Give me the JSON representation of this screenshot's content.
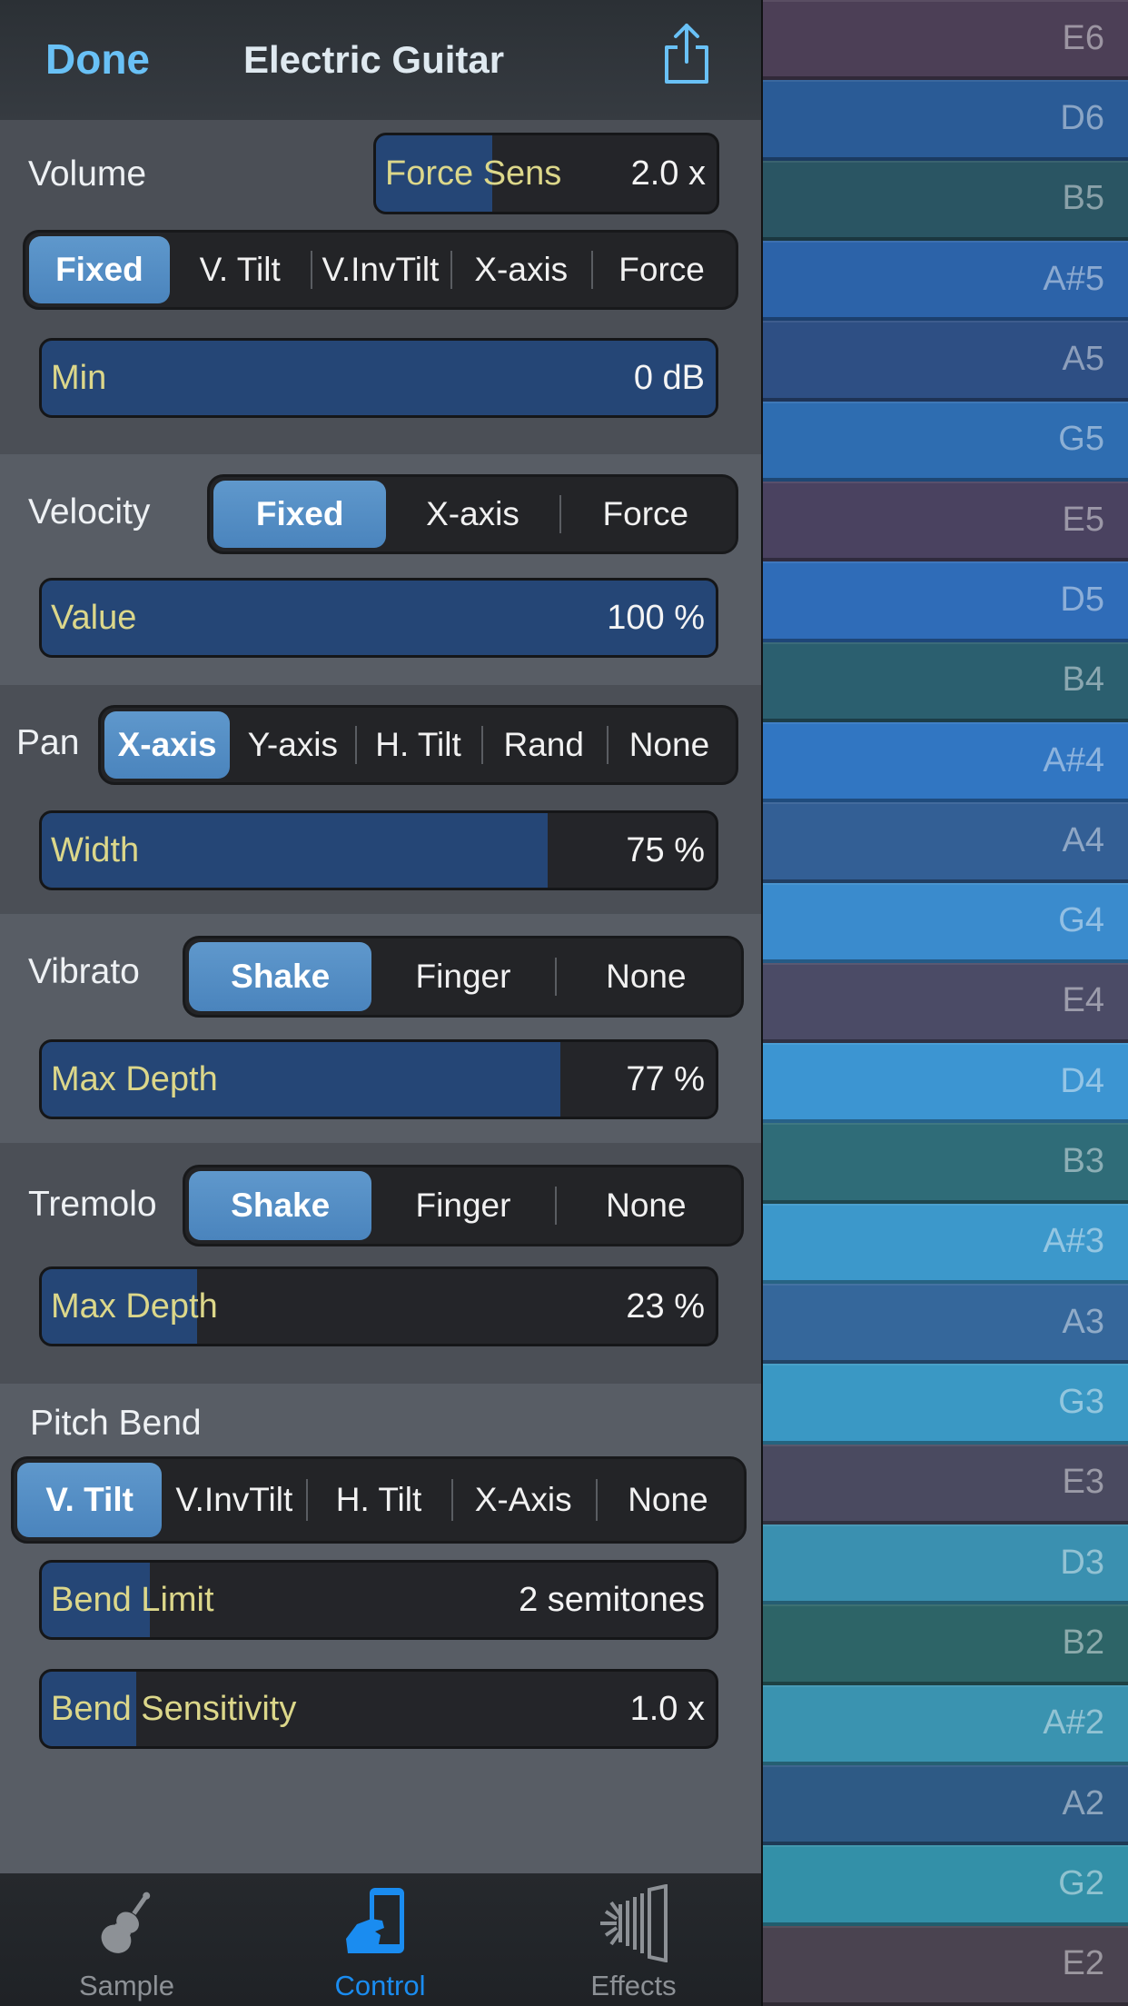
{
  "header": {
    "done_label": "Done",
    "title": "Electric Guitar"
  },
  "volume": {
    "label": "Volume",
    "force_sens": {
      "label": "Force Sens",
      "value": "2.0 x",
      "level": 0.34
    },
    "options": [
      "Fixed",
      "V. Tilt",
      "V.InvTilt",
      "X-axis",
      "Force"
    ],
    "selected": 0,
    "min": {
      "label": "Min",
      "value": "0 dB",
      "level": 1.0
    }
  },
  "velocity": {
    "label": "Velocity",
    "options": [
      "Fixed",
      "X-axis",
      "Force"
    ],
    "selected": 0,
    "value": {
      "label": "Value",
      "value": "100 %",
      "level": 1.0
    }
  },
  "pan": {
    "label": "Pan",
    "options": [
      "X-axis",
      "Y-axis",
      "H. Tilt",
      "Rand",
      "None"
    ],
    "selected": 0,
    "width": {
      "label": "Width",
      "value": "75 %",
      "level": 0.75
    }
  },
  "vibrato": {
    "label": "Vibrato",
    "options": [
      "Shake",
      "Finger",
      "None"
    ],
    "selected": 0,
    "max_depth": {
      "label": "Max Depth",
      "value": "77 %",
      "level": 0.77
    }
  },
  "tremolo": {
    "label": "Tremolo",
    "options": [
      "Shake",
      "Finger",
      "None"
    ],
    "selected": 0,
    "max_depth": {
      "label": "Max Depth",
      "value": "23 %",
      "level": 0.23
    }
  },
  "pitch_bend": {
    "label": "Pitch Bend",
    "options": [
      "V. Tilt",
      "V.InvTilt",
      "H. Tilt",
      "X-Axis",
      "None"
    ],
    "selected": 0,
    "bend_limit": {
      "label": "Bend Limit",
      "value": "2 semitones",
      "level": 0.16
    },
    "bend_sensitivity": {
      "label": "Bend Sensitivity",
      "value": "1.0 x",
      "level": 0.14
    }
  },
  "tabs": [
    {
      "label": "Sample",
      "icon": "violin-icon",
      "active": false
    },
    {
      "label": "Control",
      "icon": "hand-phone-icon",
      "active": true
    },
    {
      "label": "Effects",
      "icon": "effects-icon",
      "active": false
    }
  ],
  "colors": {
    "accent": "#69c1f6",
    "active_tab": "#1a8cf0",
    "inactive_tab": "#8d9196",
    "selected_segment": "#5a93c9",
    "slider_fill": "#254676",
    "slider_label": "#dcd78a"
  },
  "keys": [
    {
      "note": "E6",
      "color": "#4c3f56"
    },
    {
      "note": "D6",
      "color": "#2a5b96"
    },
    {
      "note": "B5",
      "color": "#2a5563"
    },
    {
      "note": "A#5",
      "color": "#2c63a9"
    },
    {
      "note": "A5",
      "color": "#2e4f84"
    },
    {
      "note": "G5",
      "color": "#2e6db1"
    },
    {
      "note": "E5",
      "color": "#4a4260"
    },
    {
      "note": "D5",
      "color": "#2f6cb8"
    },
    {
      "note": "B4",
      "color": "#2b5f6f"
    },
    {
      "note": "A#4",
      "color": "#3176c2"
    },
    {
      "note": "A4",
      "color": "#335f95"
    },
    {
      "note": "G4",
      "color": "#3a8bcd"
    },
    {
      "note": "E4",
      "color": "#4b4b66"
    },
    {
      "note": "D4",
      "color": "#3c95d2"
    },
    {
      "note": "B3",
      "color": "#2f6c78"
    },
    {
      "note": "A#3",
      "color": "#3c98cb"
    },
    {
      "note": "A3",
      "color": "#35679b"
    },
    {
      "note": "G3",
      "color": "#3a98c4"
    },
    {
      "note": "E3",
      "color": "#4a4a60"
    },
    {
      "note": "D3",
      "color": "#3a90b0"
    },
    {
      "note": "B2",
      "color": "#2d6467"
    },
    {
      "note": "A#2",
      "color": "#3a93b0"
    },
    {
      "note": "A2",
      "color": "#2e5a85"
    },
    {
      "note": "G2",
      "color": "#3390a8"
    },
    {
      "note": "E2",
      "color": "#4a4350"
    }
  ]
}
